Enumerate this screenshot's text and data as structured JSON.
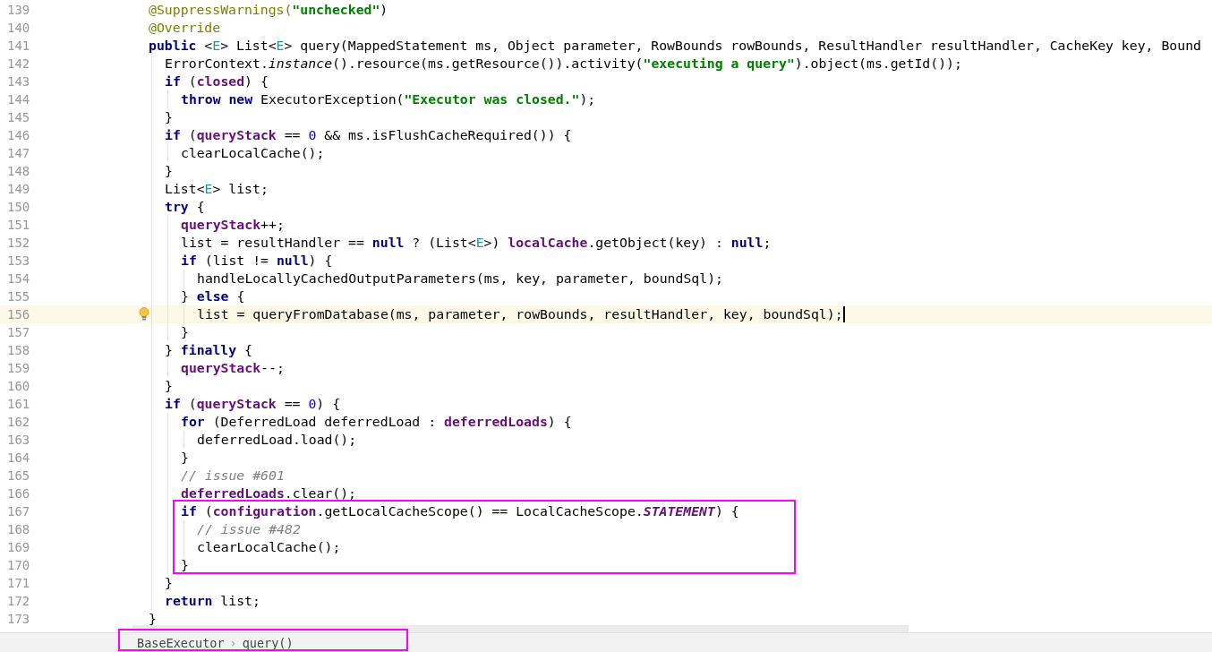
{
  "editor": {
    "lines": [
      {
        "number": "139",
        "current": false,
        "tokens": [
          {
            "kind": "annotation",
            "text": "@SuppressWarnings("
          },
          {
            "kind": "string",
            "text": "\"unchecked\""
          },
          {
            "kind": "plain",
            "text": ")"
          }
        ]
      },
      {
        "number": "140",
        "current": false,
        "tokens": [
          {
            "kind": "annotation",
            "text": "@Override"
          }
        ]
      },
      {
        "number": "141",
        "current": false,
        "tokens": [
          {
            "kind": "keyword",
            "text": "public"
          },
          {
            "kind": "plain",
            "text": " <"
          },
          {
            "kind": "generic",
            "text": "E"
          },
          {
            "kind": "plain",
            "text": "> List<"
          },
          {
            "kind": "generic",
            "text": "E"
          },
          {
            "kind": "plain",
            "text": "> query(MappedStatement ms, Object parameter, RowBounds rowBounds, ResultHandler resultHandler, CacheKey key, Bound"
          }
        ]
      },
      {
        "number": "142",
        "current": false,
        "tokens": [
          {
            "kind": "plain",
            "text": "  ErrorContext."
          },
          {
            "kind": "static_call",
            "text": "instance"
          },
          {
            "kind": "plain",
            "text": "().resource(ms.getResource()).activity("
          },
          {
            "kind": "string",
            "text": "\"executing a query\""
          },
          {
            "kind": "plain",
            "text": ").object(ms.getId());"
          }
        ]
      },
      {
        "number": "143",
        "current": false,
        "tokens": [
          {
            "kind": "keyword",
            "text": "  if"
          },
          {
            "kind": "plain",
            "text": " ("
          },
          {
            "kind": "field",
            "text": "closed"
          },
          {
            "kind": "plain",
            "text": ") {"
          }
        ]
      },
      {
        "number": "144",
        "current": false,
        "tokens": [
          {
            "kind": "keyword",
            "text": "    throw new"
          },
          {
            "kind": "plain",
            "text": " ExecutorException("
          },
          {
            "kind": "string",
            "text": "\"Executor was closed.\""
          },
          {
            "kind": "plain",
            "text": ");"
          }
        ]
      },
      {
        "number": "145",
        "current": false,
        "tokens": [
          {
            "kind": "plain",
            "text": "  }"
          }
        ]
      },
      {
        "number": "146",
        "current": false,
        "tokens": [
          {
            "kind": "keyword",
            "text": "  if"
          },
          {
            "kind": "plain",
            "text": " ("
          },
          {
            "kind": "field",
            "text": "queryStack"
          },
          {
            "kind": "plain",
            "text": " == "
          },
          {
            "kind": "number",
            "text": "0"
          },
          {
            "kind": "plain",
            "text": " && ms.isFlushCacheRequired()) {"
          }
        ]
      },
      {
        "number": "147",
        "current": false,
        "tokens": [
          {
            "kind": "plain",
            "text": "    clearLocalCache();"
          }
        ]
      },
      {
        "number": "148",
        "current": false,
        "tokens": [
          {
            "kind": "plain",
            "text": "  }"
          }
        ]
      },
      {
        "number": "149",
        "current": false,
        "tokens": [
          {
            "kind": "plain",
            "text": "  List<"
          },
          {
            "kind": "generic",
            "text": "E"
          },
          {
            "kind": "plain",
            "text": "> list;"
          }
        ]
      },
      {
        "number": "150",
        "current": false,
        "tokens": [
          {
            "kind": "keyword",
            "text": "  try"
          },
          {
            "kind": "plain",
            "text": " {"
          }
        ]
      },
      {
        "number": "151",
        "current": false,
        "tokens": [
          {
            "kind": "field",
            "text": "    queryStack"
          },
          {
            "kind": "plain",
            "text": "++;"
          }
        ]
      },
      {
        "number": "152",
        "current": false,
        "tokens": [
          {
            "kind": "plain",
            "text": "    list = resultHandler == "
          },
          {
            "kind": "keyword",
            "text": "null"
          },
          {
            "kind": "plain",
            "text": " ? (List<"
          },
          {
            "kind": "generic",
            "text": "E"
          },
          {
            "kind": "plain",
            "text": ">) "
          },
          {
            "kind": "field",
            "text": "localCache"
          },
          {
            "kind": "plain",
            "text": ".getObject(key) : "
          },
          {
            "kind": "keyword",
            "text": "null"
          },
          {
            "kind": "plain",
            "text": ";"
          }
        ]
      },
      {
        "number": "153",
        "current": false,
        "tokens": [
          {
            "kind": "keyword",
            "text": "    if"
          },
          {
            "kind": "plain",
            "text": " (list != "
          },
          {
            "kind": "keyword",
            "text": "null"
          },
          {
            "kind": "plain",
            "text": ") {"
          }
        ]
      },
      {
        "number": "154",
        "current": false,
        "tokens": [
          {
            "kind": "plain",
            "text": "      handleLocallyCachedOutputParameters(ms, key, parameter, boundSql);"
          }
        ]
      },
      {
        "number": "155",
        "current": false,
        "tokens": [
          {
            "kind": "plain",
            "text": "    } "
          },
          {
            "kind": "keyword",
            "text": "else"
          },
          {
            "kind": "plain",
            "text": " {"
          }
        ]
      },
      {
        "number": "156",
        "current": true,
        "tokens": [
          {
            "kind": "plain",
            "text": "      list = queryFromDatabase(ms, parameter, rowBounds, resultHandler, key, boundSql);"
          }
        ]
      },
      {
        "number": "157",
        "current": false,
        "tokens": [
          {
            "kind": "plain",
            "text": "    }"
          }
        ]
      },
      {
        "number": "158",
        "current": false,
        "tokens": [
          {
            "kind": "plain",
            "text": "  } "
          },
          {
            "kind": "keyword",
            "text": "finally"
          },
          {
            "kind": "plain",
            "text": " {"
          }
        ]
      },
      {
        "number": "159",
        "current": false,
        "tokens": [
          {
            "kind": "field",
            "text": "    queryStack"
          },
          {
            "kind": "plain",
            "text": "--;"
          }
        ]
      },
      {
        "number": "160",
        "current": false,
        "tokens": [
          {
            "kind": "plain",
            "text": "  }"
          }
        ]
      },
      {
        "number": "161",
        "current": false,
        "tokens": [
          {
            "kind": "keyword",
            "text": "  if"
          },
          {
            "kind": "plain",
            "text": " ("
          },
          {
            "kind": "field",
            "text": "queryStack"
          },
          {
            "kind": "plain",
            "text": " == "
          },
          {
            "kind": "number",
            "text": "0"
          },
          {
            "kind": "plain",
            "text": ") {"
          }
        ]
      },
      {
        "number": "162",
        "current": false,
        "tokens": [
          {
            "kind": "keyword",
            "text": "    for"
          },
          {
            "kind": "plain",
            "text": " (DeferredLoad deferredLoad : "
          },
          {
            "kind": "field",
            "text": "deferredLoads"
          },
          {
            "kind": "plain",
            "text": ") {"
          }
        ]
      },
      {
        "number": "163",
        "current": false,
        "tokens": [
          {
            "kind": "plain",
            "text": "      deferredLoad.load();"
          }
        ]
      },
      {
        "number": "164",
        "current": false,
        "tokens": [
          {
            "kind": "plain",
            "text": "    }"
          }
        ]
      },
      {
        "number": "165",
        "current": false,
        "tokens": [
          {
            "kind": "comment",
            "text": "    // issue #601"
          }
        ]
      },
      {
        "number": "166",
        "current": false,
        "tokens": [
          {
            "kind": "field",
            "text": "    deferredLoads"
          },
          {
            "kind": "plain",
            "text": ".clear();"
          }
        ]
      },
      {
        "number": "167",
        "current": false,
        "tokens": [
          {
            "kind": "keyword",
            "text": "    if"
          },
          {
            "kind": "plain",
            "text": " ("
          },
          {
            "kind": "field",
            "text": "configuration"
          },
          {
            "kind": "plain",
            "text": ".getLocalCacheScope() == LocalCacheScope."
          },
          {
            "kind": "constant",
            "text": "STATEMENT"
          },
          {
            "kind": "plain",
            "text": ") {"
          }
        ]
      },
      {
        "number": "168",
        "current": false,
        "tokens": [
          {
            "kind": "comment",
            "text": "      // issue #482"
          }
        ]
      },
      {
        "number": "169",
        "current": false,
        "tokens": [
          {
            "kind": "plain",
            "text": "      clearLocalCache();"
          }
        ]
      },
      {
        "number": "170",
        "current": false,
        "tokens": [
          {
            "kind": "plain",
            "text": "    }"
          }
        ]
      },
      {
        "number": "171",
        "current": false,
        "tokens": [
          {
            "kind": "plain",
            "text": "  }"
          }
        ]
      },
      {
        "number": "172",
        "current": false,
        "tokens": [
          {
            "kind": "keyword",
            "text": "  return"
          },
          {
            "kind": "plain",
            "text": " list;"
          }
        ]
      },
      {
        "number": "173",
        "current": false,
        "tokens": [
          {
            "kind": "plain",
            "text": "}"
          }
        ]
      }
    ]
  },
  "breadcrumb": {
    "items": [
      "BaseExecutor",
      "query()"
    ],
    "separator": "›"
  }
}
